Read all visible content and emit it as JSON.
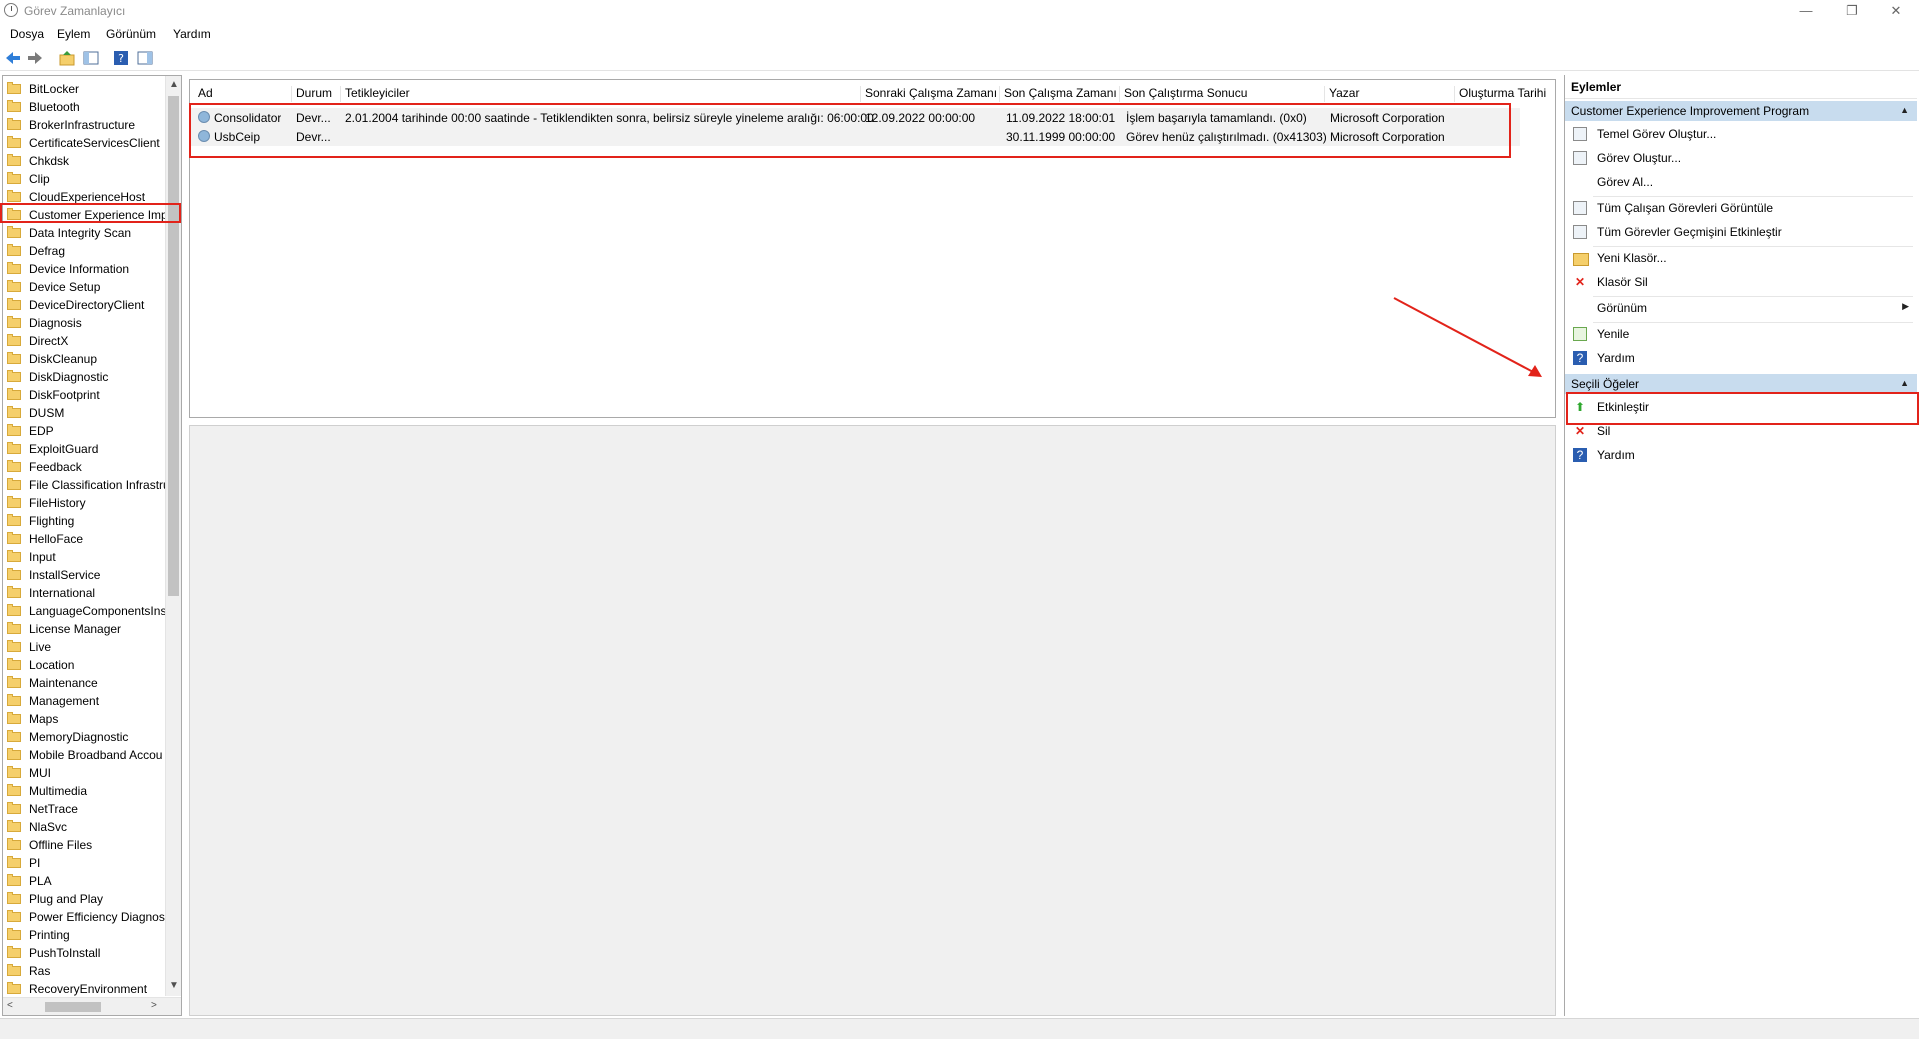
{
  "window": {
    "title": "Görev Zamanlayıcı",
    "minimize_glyph": "—",
    "restore_glyph": "❐",
    "close_glyph": "✕"
  },
  "menu": [
    "Dosya",
    "Eylem",
    "Görünüm",
    "Yardım"
  ],
  "toolbar": {
    "icons": [
      "back-arrow-icon",
      "forward-arrow-icon",
      "folder-up-icon",
      "console-tree-icon",
      "help-icon",
      "action-pane-icon"
    ]
  },
  "tree": {
    "selected_index": 7,
    "items": [
      "BitLocker",
      "Bluetooth",
      "BrokerInfrastructure",
      "CertificateServicesClient",
      "Chkdsk",
      "Clip",
      "CloudExperienceHost",
      "Customer Experience Imp",
      "Data Integrity Scan",
      "Defrag",
      "Device Information",
      "Device Setup",
      "DeviceDirectoryClient",
      "Diagnosis",
      "DirectX",
      "DiskCleanup",
      "DiskDiagnostic",
      "DiskFootprint",
      "DUSM",
      "EDP",
      "ExploitGuard",
      "Feedback",
      "File Classification Infrastru",
      "FileHistory",
      "Flighting",
      "HelloFace",
      "Input",
      "InstallService",
      "International",
      "LanguageComponentsIns",
      "License Manager",
      "Live",
      "Location",
      "Maintenance",
      "Management",
      "Maps",
      "MemoryDiagnostic",
      "Mobile Broadband Accou",
      "MUI",
      "Multimedia",
      "NetTrace",
      "NlaSvc",
      "Offline Files",
      "PI",
      "PLA",
      "Plug and Play",
      "Power Efficiency Diagnost",
      "Printing",
      "PushToInstall",
      "Ras",
      "RecoveryEnvironment"
    ]
  },
  "tasks": {
    "columns": [
      "Ad",
      "Durum",
      "Tetikleyiciler",
      "Sonraki Çalışma Zamanı",
      "Son Çalışma Zamanı",
      "Son Çalıştırma Sonucu",
      "Yazar",
      "Oluşturma Tarihi"
    ],
    "rows": [
      [
        "Consolidator",
        "Devr...",
        "2.01.2004 tarihinde 00:00 saatinde - Tetiklendikten sonra, belirsiz süreyle yineleme aralığı: 06:00:00",
        "12.09.2022 00:00:00",
        "11.09.2022 18:00:01",
        "İşlem başarıyla tamamlandı. (0x0)",
        "Microsoft Corporation",
        ""
      ],
      [
        "UsbCeip",
        "Devr...",
        "",
        "",
        "30.11.1999 00:00:00",
        "Görev henüz çalıştırılmadı. (0x41303)",
        "Microsoft Corporation",
        ""
      ]
    ]
  },
  "actions": {
    "title": "Eylemler",
    "section1_title": "Customer Experience Improvement Program",
    "section1_items": [
      {
        "label": "Temel Görev Oluştur...",
        "icon": "create-basic-task-icon"
      },
      {
        "label": "Görev Oluştur...",
        "icon": "create-task-icon"
      },
      {
        "label": "Görev Al...",
        "icon": ""
      },
      {
        "label": "Tüm Çalışan Görevleri Görüntüle",
        "icon": "running-tasks-icon"
      },
      {
        "label": "Tüm Görevler Geçmişini Etkinleştir",
        "icon": "history-icon"
      },
      {
        "label": "Yeni Klasör...",
        "icon": "new-folder-icon"
      },
      {
        "label": "Klasör Sil",
        "icon": "delete-folder-icon"
      },
      {
        "label": "Görünüm",
        "icon": ""
      },
      {
        "label": "Yenile",
        "icon": "refresh-icon"
      },
      {
        "label": "Yardım",
        "icon": "help-icon"
      }
    ],
    "section2_title": "Seçili Öğeler",
    "section2_items": [
      {
        "label": "Etkinleştir",
        "icon": "enable-arrow-icon"
      },
      {
        "label": "Sil",
        "icon": "delete-icon"
      },
      {
        "label": "Yardım",
        "icon": "help-icon"
      }
    ]
  },
  "glyphs": {
    "collapse": "▲",
    "submenu": "▶",
    "scroll_up": "▲",
    "scroll_down": "▼",
    "scroll_left": "<",
    "scroll_right": ">",
    "help": "?",
    "delete": "✕",
    "enable": "⬆"
  },
  "colors": {
    "accent_header": "#c8dcee",
    "annotation_red": "#e2231a",
    "folder_yellow": "#f5cf6b"
  }
}
